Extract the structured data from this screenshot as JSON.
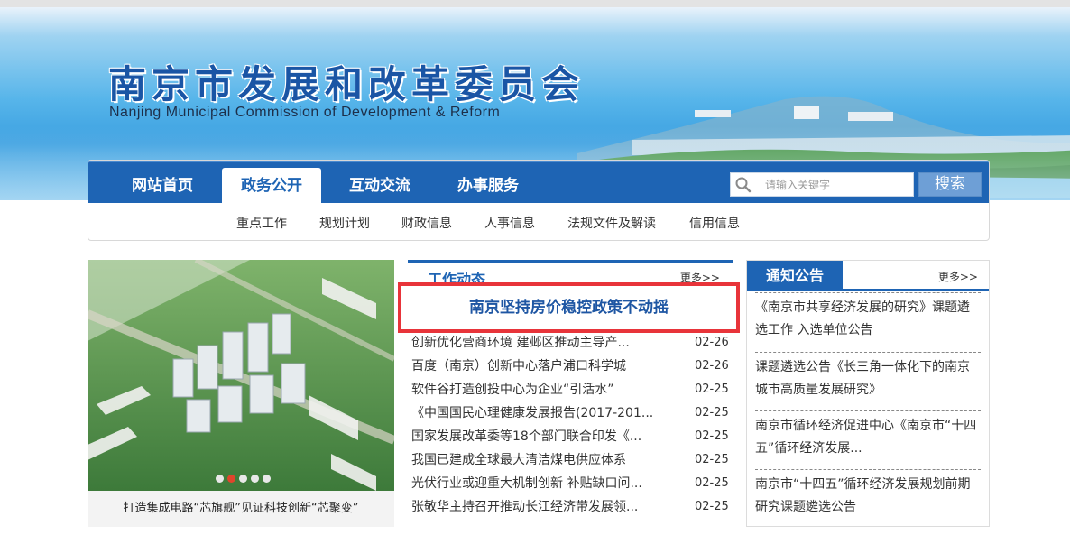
{
  "header": {
    "title": "南京市发展和改革委员会",
    "subtitle": "Nanjing Municipal Commission of Development & Reform"
  },
  "nav": {
    "tabs": [
      {
        "label": "网站首页"
      },
      {
        "label": "政务公开",
        "active": true
      },
      {
        "label": "互动交流"
      },
      {
        "label": "办事服务"
      }
    ],
    "search": {
      "placeholder": "请输入关键字",
      "button": "搜索"
    },
    "sub_items": [
      "重点工作",
      "规划计划",
      "财政信息",
      "人事信息",
      "法规文件及解读",
      "信用信息"
    ]
  },
  "slider": {
    "caption": "打造集成电路“芯旗舰”见证科技创新“芯聚变”",
    "dot_count": 5,
    "active_dot": 1
  },
  "news": {
    "title": "工作动态",
    "more": "更多>>",
    "headline": "南京坚持房价稳控政策不动摇",
    "items": [
      {
        "title": "创新优化营商环境 建邺区推动主导产...",
        "date": "02-26"
      },
      {
        "title": "百度（南京）创新中心落户浦口科学城",
        "date": "02-26"
      },
      {
        "title": "软件谷打造创投中心为企业“引活水”",
        "date": "02-25"
      },
      {
        "title": "《中国国民心理健康发展报告(2017-201...",
        "date": "02-25"
      },
      {
        "title": "国家发展改革委等18个部门联合印发《...",
        "date": "02-25"
      },
      {
        "title": "我国已建成全球最大清洁煤电供应体系",
        "date": "02-25"
      },
      {
        "title": "光伏行业或迎重大机制创新 补贴缺口问...",
        "date": "02-25"
      },
      {
        "title": "张敬华主持召开推动长江经济带发展领...",
        "date": "02-25"
      }
    ]
  },
  "notice": {
    "title": "通知公告",
    "more": "更多>>",
    "items": [
      "《南京市共享经济发展的研究》课题遴选工作 入选单位公告",
      "课题遴选公告《长三角一体化下的南京城市高质量发展研究》",
      "南京市循环经济促进中心《南京市“十四五”循环经济发展...",
      "南京市“十四五”循环经济发展规划前期研究课题遴选公告"
    ]
  },
  "colors": {
    "brand_blue": "#1e64b4",
    "headline_border": "#e8343a",
    "active_dot": "#e0452c"
  }
}
